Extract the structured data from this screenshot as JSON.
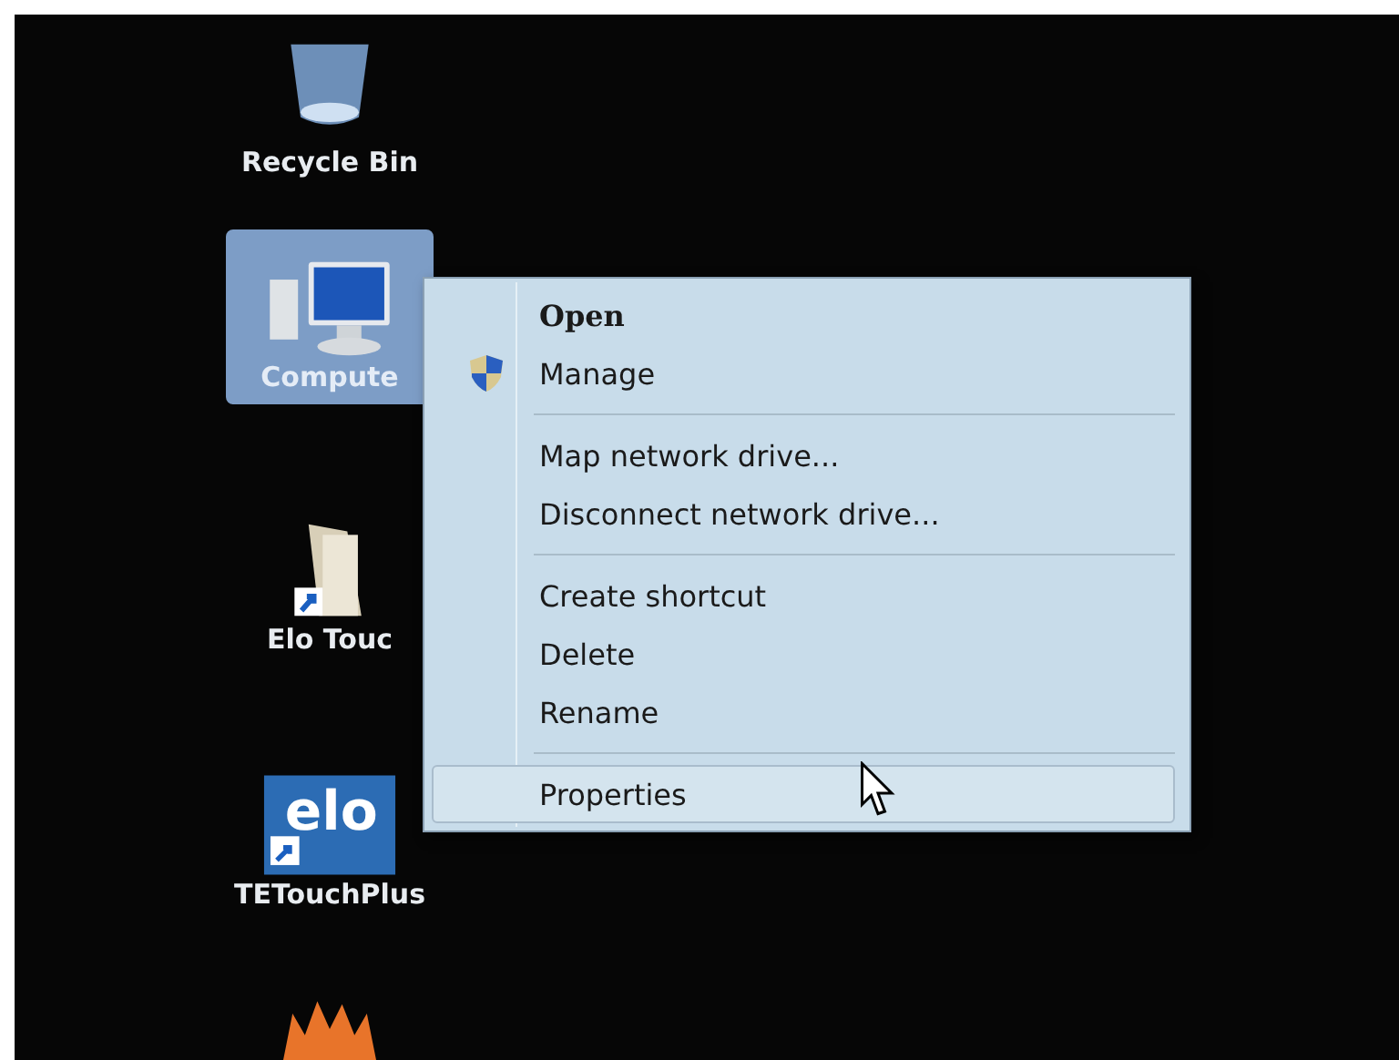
{
  "desktop_icons": [
    {
      "kind": "recycle",
      "label": "Recycle Bin",
      "selected": false
    },
    {
      "kind": "computer",
      "label": "Compute",
      "selected": true
    },
    {
      "kind": "folder",
      "label": "Elo Touc",
      "selected": false
    },
    {
      "kind": "elo",
      "label": "TETouchPlus",
      "logo_text": "elo",
      "selected": false
    },
    {
      "kind": "flame",
      "selected": false
    }
  ],
  "context_menu": {
    "groups": [
      [
        {
          "label": "Open",
          "default": true,
          "elevated": false,
          "selected": false
        },
        {
          "label": "Manage",
          "default": false,
          "elevated": true,
          "selected": false
        }
      ],
      [
        {
          "label": "Map network drive...",
          "default": false,
          "elevated": false,
          "selected": false
        },
        {
          "label": "Disconnect network drive...",
          "default": false,
          "elevated": false,
          "selected": false
        }
      ],
      [
        {
          "label": "Create shortcut",
          "default": false,
          "elevated": false,
          "selected": false
        },
        {
          "label": "Delete",
          "default": false,
          "elevated": false,
          "selected": false
        },
        {
          "label": "Rename",
          "default": false,
          "elevated": false,
          "selected": false
        }
      ],
      [
        {
          "label": "Properties",
          "default": false,
          "elevated": false,
          "selected": true
        }
      ]
    ]
  }
}
